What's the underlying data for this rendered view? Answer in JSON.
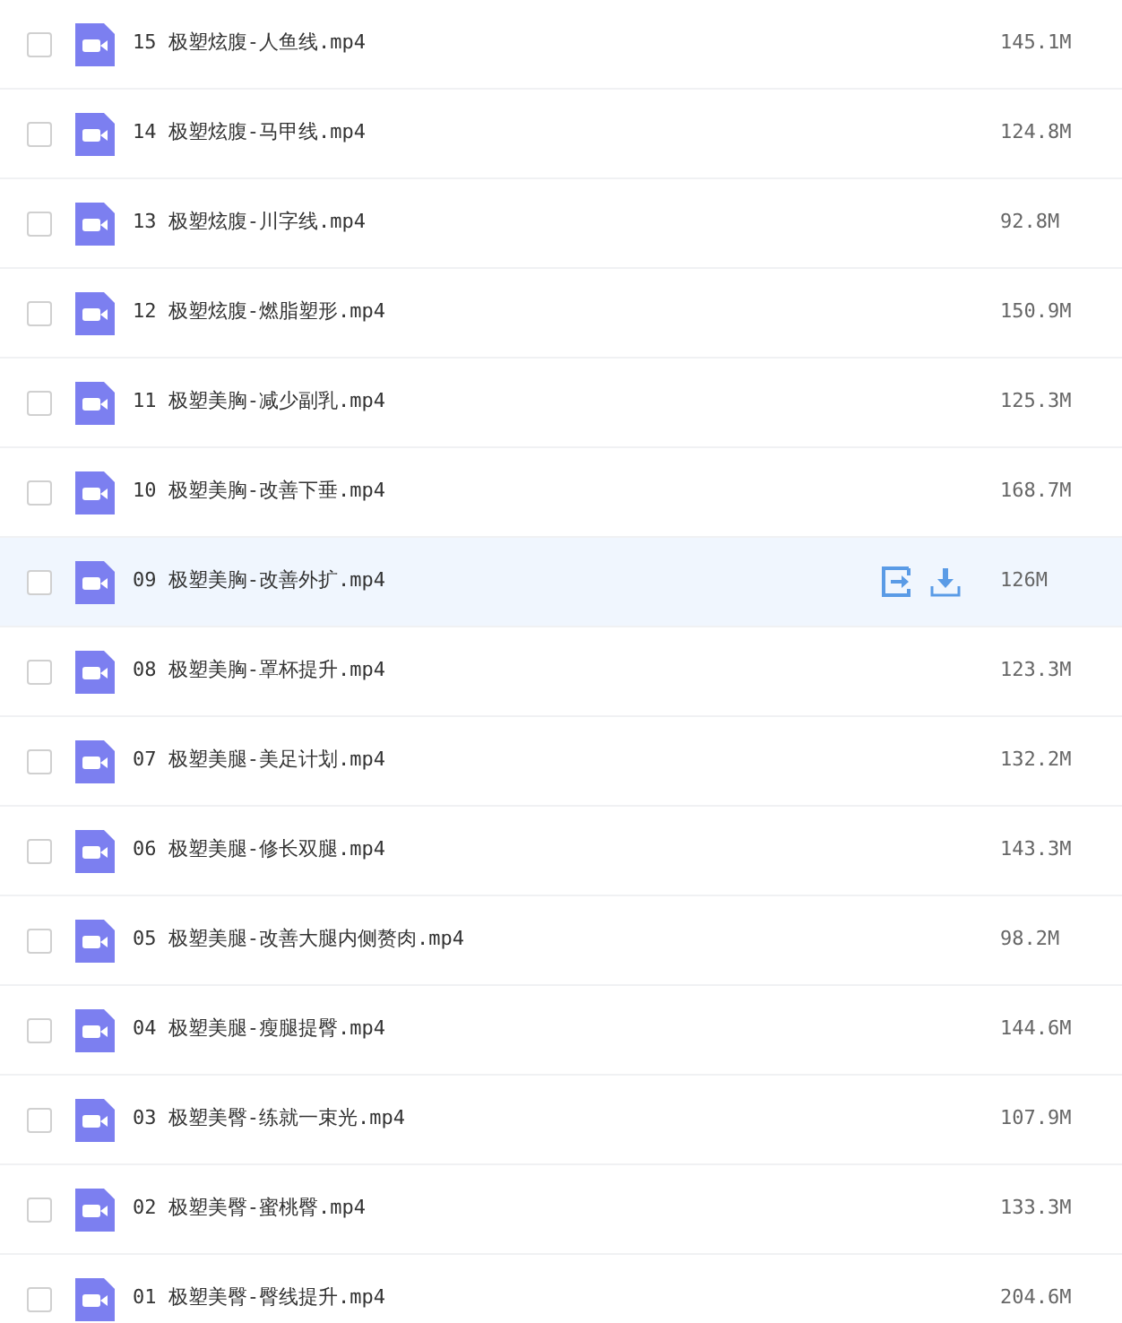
{
  "files": [
    {
      "name": "15 极塑炫腹-人鱼线.mp4",
      "size": "145.1M",
      "checked": false,
      "selected": false
    },
    {
      "name": "14 极塑炫腹-马甲线.mp4",
      "size": "124.8M",
      "checked": false,
      "selected": false
    },
    {
      "name": "13 极塑炫腹-川字线.mp4",
      "size": "92.8M",
      "checked": false,
      "selected": false
    },
    {
      "name": "12 极塑炫腹-燃脂塑形.mp4",
      "size": "150.9M",
      "checked": false,
      "selected": false
    },
    {
      "name": "11 极塑美胸-减少副乳.mp4",
      "size": "125.3M",
      "checked": false,
      "selected": false
    },
    {
      "name": "10 极塑美胸-改善下垂.mp4",
      "size": "168.7M",
      "checked": false,
      "selected": false
    },
    {
      "name": "09 极塑美胸-改善外扩.mp4",
      "size": "126M",
      "checked": false,
      "selected": true
    },
    {
      "name": "08 极塑美胸-罩杯提升.mp4",
      "size": "123.3M",
      "checked": false,
      "selected": false
    },
    {
      "name": "07 极塑美腿-美足计划.mp4",
      "size": "132.2M",
      "checked": false,
      "selected": false
    },
    {
      "name": "06 极塑美腿-修长双腿.mp4",
      "size": "143.3M",
      "checked": false,
      "selected": false
    },
    {
      "name": "05 极塑美腿-改善大腿内侧赘肉.mp4",
      "size": "98.2M",
      "checked": false,
      "selected": false
    },
    {
      "name": "04 极塑美腿-瘦腿提臀.mp4",
      "size": "144.6M",
      "checked": false,
      "selected": false
    },
    {
      "name": "03 极塑美臀-练就一束光.mp4",
      "size": "107.9M",
      "checked": false,
      "selected": false
    },
    {
      "name": "02 极塑美臀-蜜桃臀.mp4",
      "size": "133.3M",
      "checked": false,
      "selected": false
    },
    {
      "name": "01 极塑美臀-臀线提升.mp4",
      "size": "204.6M",
      "checked": false,
      "selected": false
    }
  ]
}
